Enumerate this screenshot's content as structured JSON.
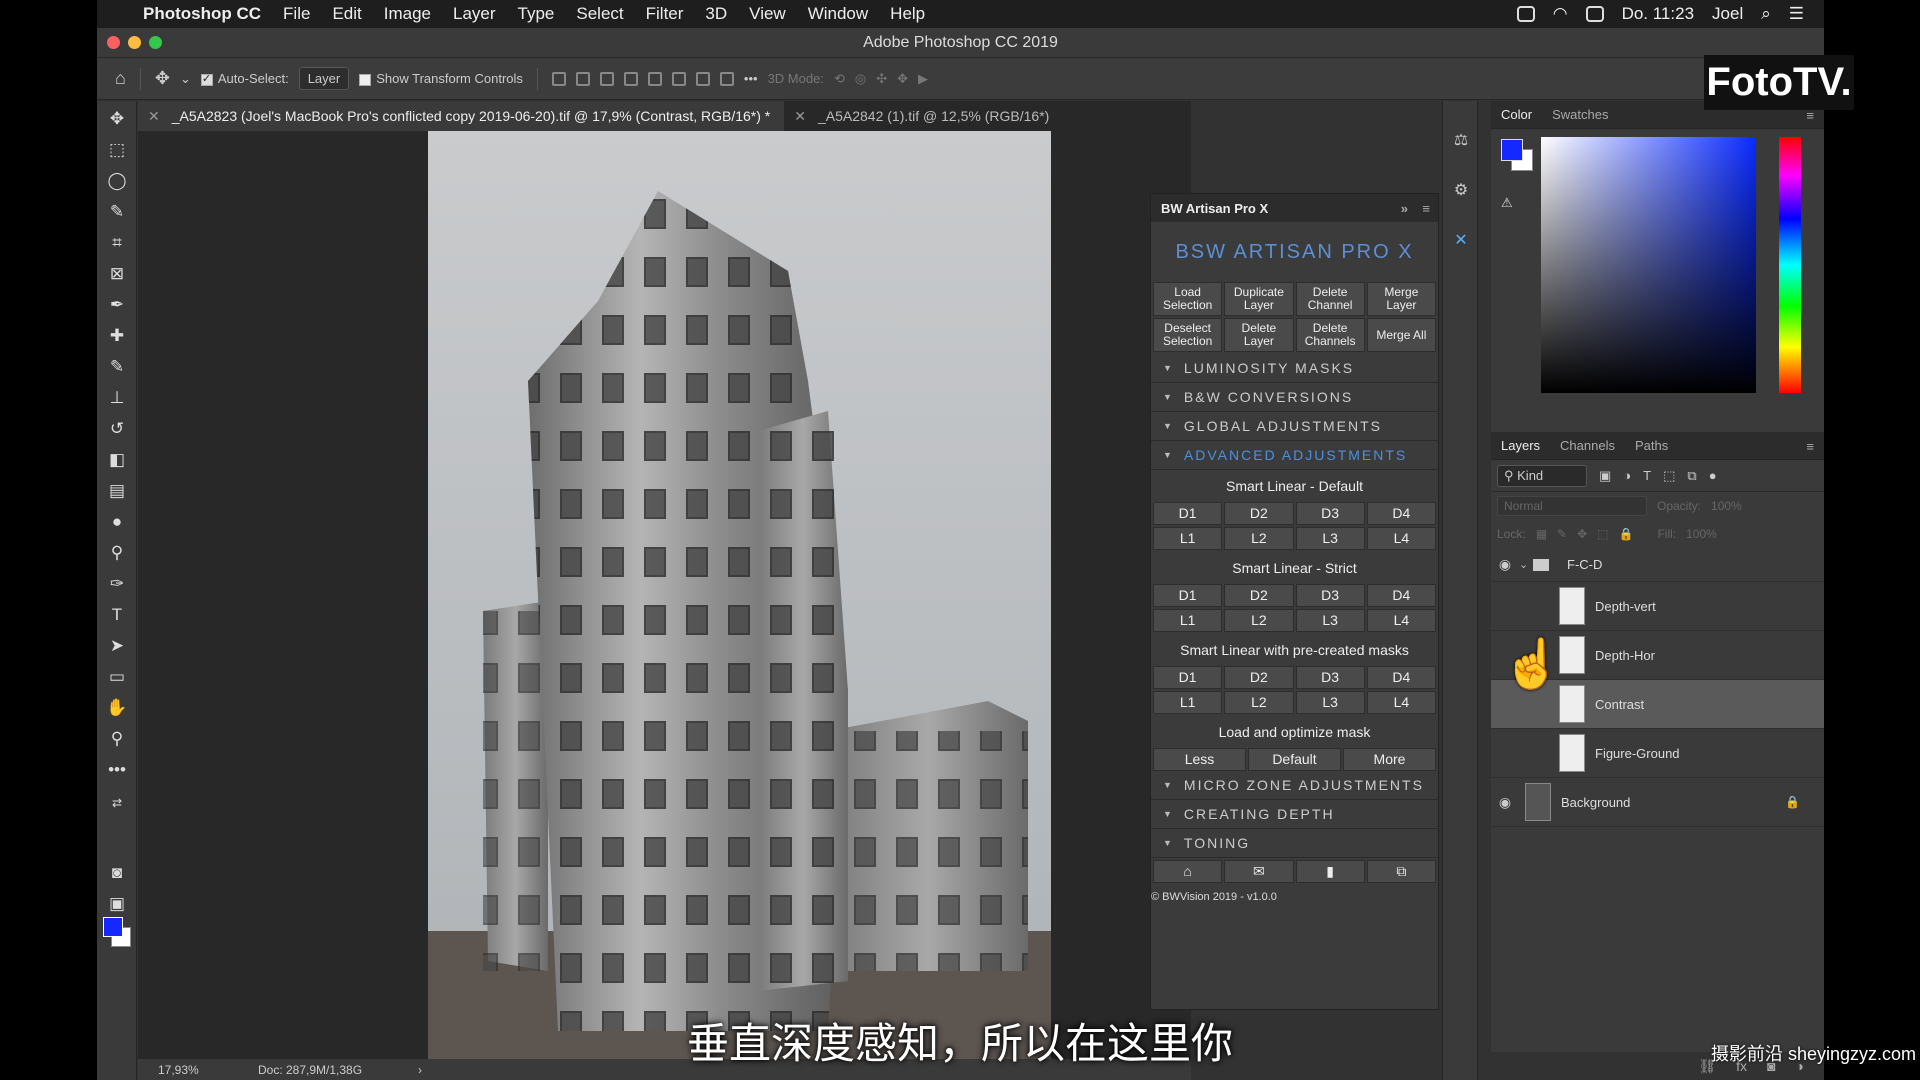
{
  "menubar": {
    "app_name": "Photoshop CC",
    "items": [
      "File",
      "Edit",
      "Image",
      "Layer",
      "Type",
      "Select",
      "Filter",
      "3D",
      "View",
      "Window",
      "Help"
    ],
    "clock": "Do. 11:23",
    "user": "Joel"
  },
  "window": {
    "title": "Adobe Photoshop CC 2019"
  },
  "options": {
    "auto_select_label": "Auto-Select:",
    "auto_select_value": "Layer",
    "show_transform_label": "Show Transform Controls",
    "more": "•••",
    "mode_3d": "3D Mode:"
  },
  "tabs": [
    {
      "close": "✕",
      "label": "_A5A2823 (Joel's MacBook Pro's conflicted copy 2019-06-20).tif @ 17,9% (Contrast, RGB/16*) *"
    },
    {
      "close": "✕",
      "label": "_A5A2842 (1).tif @ 12,5% (RGB/16*)"
    }
  ],
  "status": {
    "zoom": "17,93%",
    "doc": "Doc: 287,9M/1,38G",
    "arrow": "›"
  },
  "bw": {
    "title": "BW Artisan Pro X",
    "logo": "BSW ARTISAN PRO X",
    "top_buttons": [
      "Load Selection",
      "Duplicate Layer",
      "Delete Channel",
      "Merge Layer",
      "Deselect Selection",
      "Delete Layer",
      "Delete Channels",
      "Merge All"
    ],
    "sections_top": [
      "LUMINOSITY MASKS",
      "B&W CONVERSIONS",
      "GLOBAL ADJUSTMENTS",
      "ADVANCED ADJUSTMENTS"
    ],
    "group1_label": "Smart Linear - Default",
    "group2_label": "Smart Linear - Strict",
    "group3_label": "Smart Linear with pre-created masks",
    "d_buttons": [
      "D1",
      "D2",
      "D3",
      "D4"
    ],
    "l_buttons": [
      "L1",
      "L2",
      "L3",
      "L4"
    ],
    "mask_label": "Load and optimize mask",
    "mask_buttons": [
      "Less",
      "Default",
      "More"
    ],
    "sections_bottom": [
      "MICRO ZONE ADJUSTMENTS",
      "CREATING DEPTH",
      "TONING"
    ],
    "footer": "© BWVision 2019 - v1.0.0"
  },
  "color_panel": {
    "tabs": [
      "Color",
      "Swatches"
    ],
    "fg": "#1428ff",
    "bg": "#ffffff"
  },
  "layers_panel": {
    "tabs": [
      "Layers",
      "Channels",
      "Paths"
    ],
    "kind": "Kind",
    "blend": "Normal",
    "opacity_label": "Opacity:",
    "opacity_value": "100%",
    "lock_label": "Lock:",
    "fill_label": "Fill:",
    "fill_value": "100%",
    "layers": [
      {
        "name": "F-C-D",
        "type": "group"
      },
      {
        "name": "Depth-vert",
        "type": "layer"
      },
      {
        "name": "Depth-Hor",
        "type": "layer"
      },
      {
        "name": "Contrast",
        "type": "layer",
        "selected": true
      },
      {
        "name": "Figure-Ground",
        "type": "layer"
      },
      {
        "name": "Background",
        "type": "background"
      }
    ]
  },
  "overlay": {
    "brand": "FotoTV.",
    "subtitle": "垂直深度感知，所以在这里你",
    "watermark": "摄影前沿 sheyingzyz.com"
  }
}
